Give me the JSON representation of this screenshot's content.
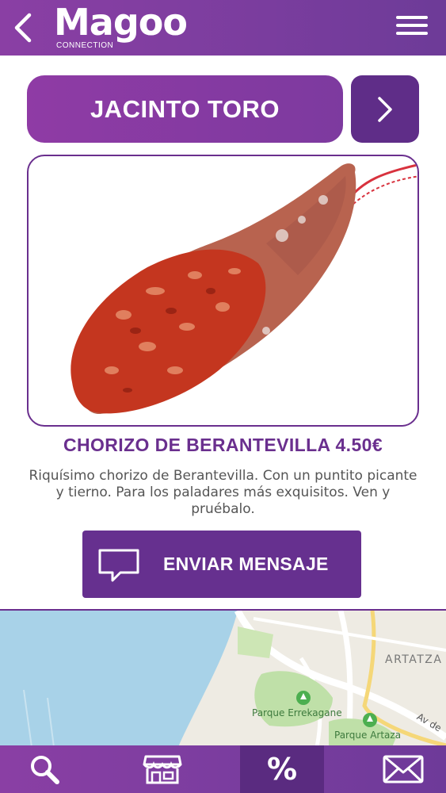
{
  "header": {
    "back_icon": "chevron-left-icon",
    "logo_text": "Magoo",
    "logo_subtext": "CONNECTION",
    "menu_icon": "hamburger-menu-icon"
  },
  "store": {
    "name": "JACINTO TORO",
    "next_icon": "chevron-right-icon"
  },
  "product": {
    "image": "chorizo-image",
    "title": "CHORIZO DE BERANTEVILLA 4.50€",
    "description": "Riquísimo chorizo de Berantevilla. Con un puntito picante y tierno. Para los paladares más exquisitos. Ven y pruébalo."
  },
  "actions": {
    "send_message_label": "ENVIAR MENSAJE",
    "send_message_icon": "speech-bubble-icon"
  },
  "map": {
    "labels": {
      "area": "ARTATZA",
      "park1": "Parque Errekagane",
      "park2": "Parque Artaza",
      "street": "Av de"
    }
  },
  "bottom_nav": {
    "items": [
      {
        "icon": "search-icon"
      },
      {
        "icon": "store-icon"
      },
      {
        "icon": "percent-icon",
        "label": "%",
        "active": true
      },
      {
        "icon": "mail-icon"
      }
    ]
  },
  "colors": {
    "brand_purple": "#7a3d9e",
    "dark_purple": "#5f2d88",
    "title_purple": "#6a2f8e"
  }
}
